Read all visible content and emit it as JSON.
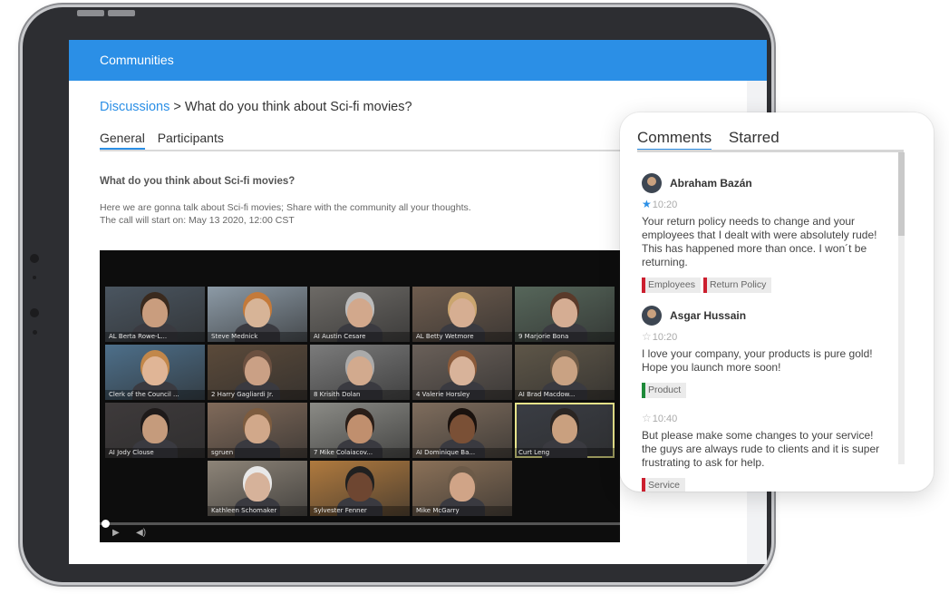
{
  "app_bar": {
    "title": "Communities"
  },
  "breadcrumb": {
    "link": "Discussions",
    "separator": " > ",
    "current": "What do you think about Sci-fi movies?"
  },
  "tabs": [
    {
      "label": "General",
      "active": true
    },
    {
      "label": "Participants",
      "active": false
    }
  ],
  "post": {
    "title": "What do you think about Sci-fi movies?",
    "description_line1": "Here we are gonna talk about Sci-fi movies; Share with the community all your thoughts.",
    "description_line2": "The call will start on: May 13 2020, 12:00 CST"
  },
  "video_call": {
    "participants": [
      {
        "name": "AL Berta Rowe-L...",
        "bg": "#4a5560",
        "skin": "#c99d7e",
        "hair": "#3a2a1e"
      },
      {
        "name": "Steve Mednick",
        "bg": "#8c9aa6",
        "skin": "#d7b497",
        "hair": "#c47a3a"
      },
      {
        "name": "AI Austin Cesare",
        "bg": "#6d6a66",
        "skin": "#d2a88c",
        "hair": "#bbbbbb"
      },
      {
        "name": "AL Betty Wetmore",
        "bg": "#6e5c4e",
        "skin": "#d6ae92",
        "hair": "#caa56f"
      },
      {
        "name": "9 Marjorie Bona",
        "bg": "#56665a",
        "skin": "#d5ad93",
        "hair": "#5a3a2a"
      },
      {
        "name": "Clerk of the Council ...",
        "bg": "#4d6f8a",
        "skin": "#e0b596",
        "hair": "#c2874a"
      },
      {
        "name": "2 Harry Gagliardi Jr.",
        "bg": "#5b4a3a",
        "skin": "#caa085",
        "hair": "#6b5040"
      },
      {
        "name": "8 Krisith Dolan",
        "bg": "#7b7b7b",
        "skin": "#d2aa8e",
        "hair": "#aaaaaa"
      },
      {
        "name": "4 Valerie Horsley",
        "bg": "#6a6059",
        "skin": "#d8b39a",
        "hair": "#8a5a3a"
      },
      {
        "name": "AI Brad Macdow...",
        "bg": "#5e5648",
        "skin": "#c9a283",
        "hair": "#6e5a46"
      },
      {
        "name": "AI Jody Clouse",
        "bg": "#3e3a3b",
        "skin": "#c59b7c",
        "hair": "#1e1a1a"
      },
      {
        "name": "sgruen",
        "bg": "#806a5a",
        "skin": "#d1a88a",
        "hair": "#7d5c3f"
      },
      {
        "name": "7 Mike Colaiacov...",
        "bg": "#8b8b86",
        "skin": "#c08f6e",
        "hair": "#2a1e18"
      },
      {
        "name": "AI Dominique Ba...",
        "bg": "#7f6d5d",
        "skin": "#7a5036",
        "hair": "#1a120e"
      },
      {
        "name": "Curt Leng",
        "bg": "#3a3d44",
        "skin": "#c9a07f",
        "hair": "#2a2522"
      },
      {
        "name": "Kathleen Schomaker",
        "bg": "#8d8478",
        "skin": "#d6b29a",
        "hair": "#e8e8e8"
      },
      {
        "name": "Sylvester Fenner",
        "bg": "#b07a3e",
        "skin": "#6e4631",
        "hair": "#202020"
      },
      {
        "name": "Mike McGarry",
        "bg": "#8b7158",
        "skin": "#d0a487",
        "hair": "#6c5a48"
      }
    ],
    "controls": {
      "play_icon": "play-icon",
      "volume_icon": "volume-icon"
    }
  },
  "comments_panel": {
    "tabs": [
      {
        "label": "Comments",
        "active": true
      },
      {
        "label": "Starred",
        "active": false
      }
    ],
    "comments": [
      {
        "author": "Abraham Bazán",
        "starred": true,
        "time": "10:20",
        "text": "Your return policy needs to change and your employees that I dealt with were absolutely rude! This has happened more than once. I won´t be returning.",
        "tags": [
          {
            "label": "Employees",
            "color": "#cc1f2f"
          },
          {
            "label": "Return Policy",
            "color": "#cc1f2f"
          }
        ]
      },
      {
        "author": "Asgar Hussain",
        "starred": false,
        "time": "10:20",
        "text": "I love your company, your products is pure gold! Hope you launch more soon!",
        "tags": [
          {
            "label": "Product",
            "color": "#1e8a3a"
          }
        ]
      },
      {
        "author": "",
        "starred": false,
        "time": "10:40",
        "text": "But please make some changes to your service! the guys are always rude to clients and it is super frustrating to ask for help.",
        "tags": [
          {
            "label": "Service",
            "color": "#cc1f2f"
          }
        ]
      }
    ]
  },
  "colors": {
    "accent": "#2b8fe6",
    "negative_tag": "#cc1f2f",
    "positive_tag": "#1e8a3a"
  }
}
